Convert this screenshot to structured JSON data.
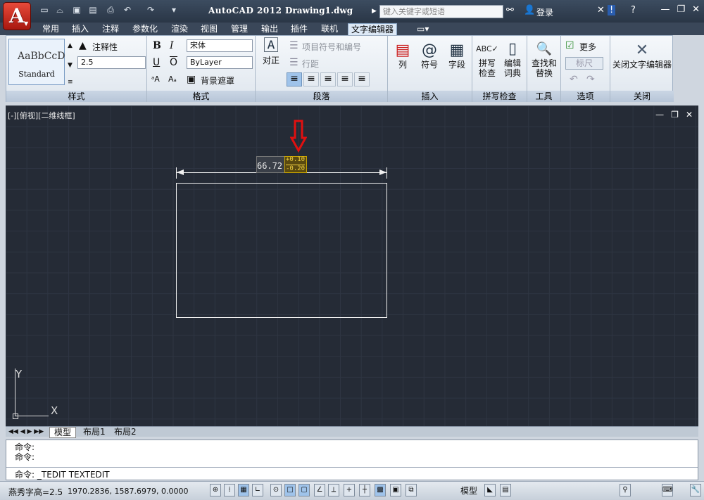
{
  "titlebar": {
    "app_name": "AutoCAD 2012",
    "document": "Drawing1.dwg",
    "search_placeholder": "键入关键字或短语",
    "login": "登录"
  },
  "tabs": [
    "常用",
    "插入",
    "注释",
    "参数化",
    "渲染",
    "视图",
    "管理",
    "输出",
    "插件",
    "联机",
    "文字编辑器"
  ],
  "ribbon": {
    "style": {
      "preview": "AaBbCcD",
      "name": "Standard",
      "annotative": "注释性",
      "height": "2.5",
      "title": "样式"
    },
    "format": {
      "bold": "B",
      "italic": "I",
      "underline": "U",
      "overline": "O",
      "font": "宋体",
      "color": "ByLayer",
      "bg_mask": "背景遮罩",
      "title": "格式"
    },
    "paragraph": {
      "justify": "对正",
      "bullets": "项目符号和编号",
      "line_spacing": "行距",
      "title": "段落"
    },
    "insert": {
      "columns": "列",
      "symbol": "符号",
      "field": "字段",
      "title": "插入"
    },
    "spell": {
      "check": "拼写\n检查",
      "dict": "编辑\n词典",
      "title": "拼写检查"
    },
    "tools": {
      "find": "查找和\n替换",
      "title": "工具"
    },
    "options": {
      "more": "更多",
      "ruler": "标尺",
      "title": "选项"
    },
    "close": {
      "label": "关闭文字编辑器",
      "title": "关闭"
    }
  },
  "viewport": {
    "label": "[-][俯视][二维线框]",
    "dim_value": "66.72",
    "tol_upper": "+0.10",
    "tol_lower": "-0.20",
    "ucs_x": "X",
    "ucs_y": "Y"
  },
  "layout_tabs": [
    "模型",
    "布局1",
    "布局2"
  ],
  "command": {
    "line1": "命令:",
    "line2": "命令:",
    "current": "命令: _TEDIT TEXTEDIT"
  },
  "status": {
    "left": "燕秀字高=2.5",
    "coords": "1970.2836, 1587.6979, 0.0000",
    "model": "模型"
  }
}
